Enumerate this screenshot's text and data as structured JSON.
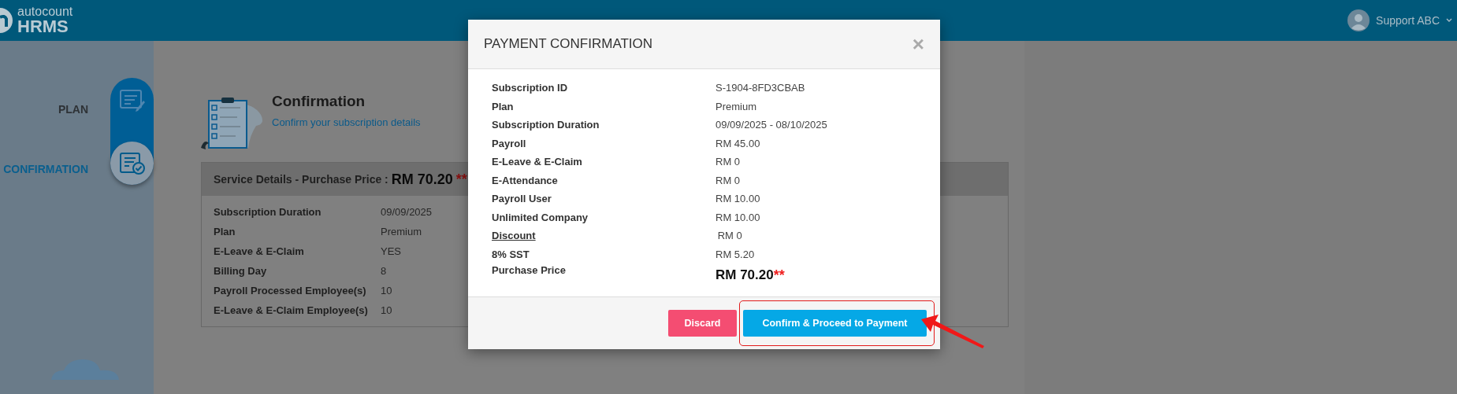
{
  "header": {
    "brand": "autocount",
    "product": "HRMS",
    "user": "Support ABC"
  },
  "steps": [
    {
      "label": "PLAN",
      "selected": false
    },
    {
      "label": "CONFIRMATION",
      "selected": true
    }
  ],
  "page": {
    "title": "Confirmation",
    "subtitle": "Confirm your subscription details"
  },
  "service_card": {
    "heading": "Service Details - Purchase Price :",
    "price": "RM 70.20",
    "price_mark": "**",
    "rows": [
      {
        "label": "Subscription Duration",
        "value": "09/09/2025"
      },
      {
        "label": "Plan",
        "value": "Premium"
      },
      {
        "label": "E-Leave & E-Claim",
        "value": "YES"
      },
      {
        "label": "Billing Day",
        "value": "8"
      },
      {
        "label": "Payroll Processed Employee(s)",
        "value": "10"
      },
      {
        "label": "E-Leave & E-Claim Employee(s)",
        "value": "10"
      }
    ]
  },
  "modal": {
    "title": "PAYMENT CONFIRMATION",
    "close": "×",
    "rows": [
      {
        "kind": "text",
        "label": "Subscription ID",
        "value": "S-1904-8FD3CBAB"
      },
      {
        "kind": "text",
        "label": "Plan",
        "value": "Premium"
      },
      {
        "kind": "text",
        "label": "Subscription Duration",
        "value": "09/09/2025 - 08/10/2025"
      },
      {
        "kind": "text",
        "label": "Payroll",
        "value": "RM 45.00"
      },
      {
        "kind": "text",
        "label": "E-Leave & E-Claim",
        "value": "RM 0"
      },
      {
        "kind": "text",
        "label": "E-Attendance",
        "value": "RM 0"
      },
      {
        "kind": "text",
        "label": "Payroll User",
        "value": "RM 10.00"
      },
      {
        "kind": "text",
        "label": "Unlimited Company",
        "value": "RM 10.00"
      },
      {
        "kind": "link",
        "label": "Discount",
        "value": "RM 0"
      },
      {
        "kind": "text",
        "label": "8% SST",
        "value": "RM 5.20"
      },
      {
        "kind": "total",
        "label": "Purchase Price",
        "value": "RM 70.20",
        "mark": "**"
      }
    ],
    "buttons": [
      {
        "kind": "discard",
        "label": "Discard",
        "highlighted": false
      },
      {
        "kind": "confirm",
        "label": "Confirm & Proceed to Payment",
        "highlighted": true
      }
    ]
  }
}
